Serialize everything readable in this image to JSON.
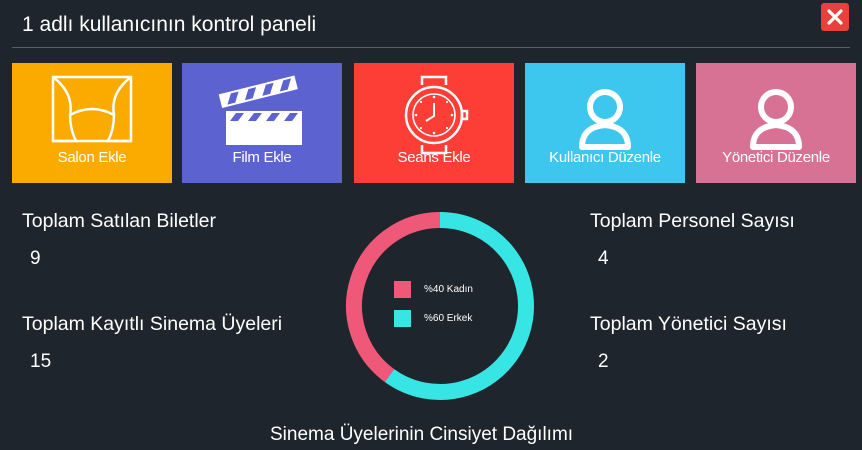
{
  "window": {
    "title": "1 adlı kullanıcının kontrol paneli"
  },
  "tiles": [
    {
      "label": "Salon Ekle",
      "icon": "curtains-icon",
      "color": "#fbab00"
    },
    {
      "label": "Film Ekle",
      "icon": "clapperboard-icon",
      "color": "#5d62d1"
    },
    {
      "label": "Seans Ekle",
      "icon": "watch-icon",
      "color": "#fc3e37"
    },
    {
      "label": "Kullanıcı Düzenle",
      "icon": "user-icon",
      "color": "#3dc7ef"
    },
    {
      "label": "Yönetici Düzenle",
      "icon": "user-icon",
      "color": "#d87295"
    }
  ],
  "stats": {
    "tickets_label": "Toplam Satılan Biletler",
    "tickets_value": "9",
    "members_label": "Toplam Kayıtlı Sinema Üyeleri",
    "members_value": "15",
    "staff_label": "Toplam Personel Sayısı",
    "staff_value": "4",
    "admins_label": "Toplam Yönetici Sayısı",
    "admins_value": "2"
  },
  "chart_data": {
    "type": "pie",
    "style": "donut",
    "title": "Sinema Üyelerinin Cinsiyet Dağılımı",
    "slices": [
      {
        "label": "%40 Kadın",
        "value": 40,
        "color": "#f0587a"
      },
      {
        "label": "%60 Erkek",
        "value": 60,
        "color": "#38e5e5"
      }
    ],
    "legend_position": "center"
  },
  "colors": {
    "background": "#1f252c",
    "close_button": "#e8413b"
  }
}
